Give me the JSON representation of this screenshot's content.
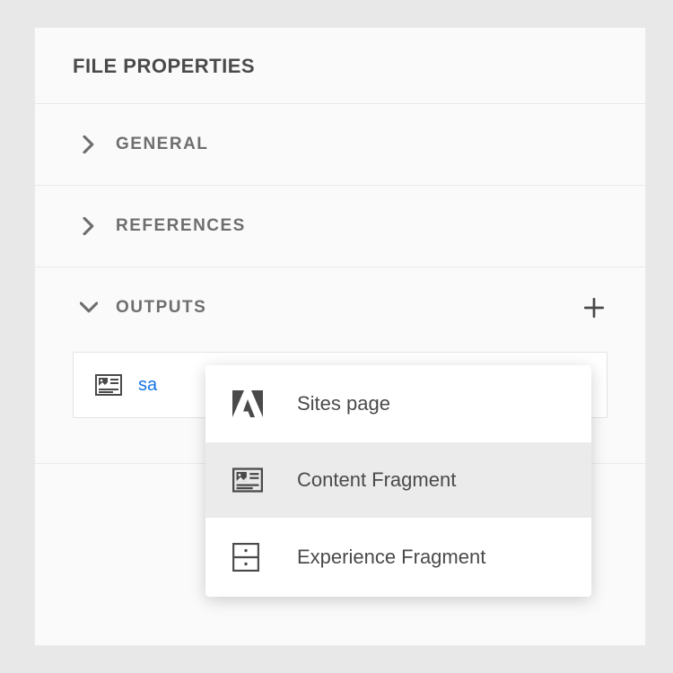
{
  "panel": {
    "title": "FILE PROPERTIES",
    "sections": [
      {
        "label": "GENERAL",
        "expanded": false
      },
      {
        "label": "REFERENCES",
        "expanded": false
      },
      {
        "label": "OUTPUTS",
        "expanded": true
      }
    ]
  },
  "outputs": {
    "addIcon": "plus",
    "items": [
      {
        "name": "sa",
        "icon": "content-fragment"
      }
    ]
  },
  "dropdown": {
    "items": [
      {
        "label": "Sites page",
        "icon": "adobe",
        "highlighted": false
      },
      {
        "label": "Content Fragment",
        "icon": "content-fragment",
        "highlighted": true
      },
      {
        "label": "Experience Fragment",
        "icon": "experience-fragment",
        "highlighted": false
      }
    ]
  }
}
